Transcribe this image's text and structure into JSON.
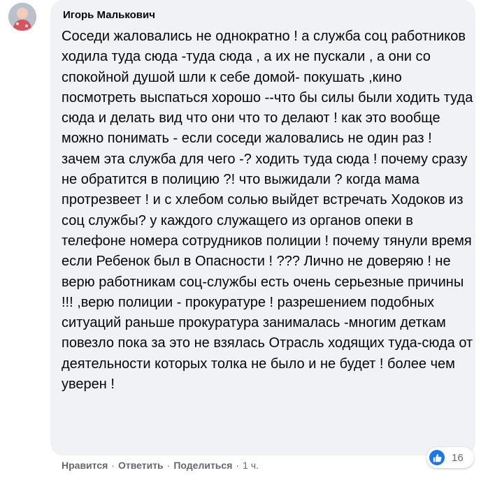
{
  "comment": {
    "author": "Игорь Малькович",
    "text": "Соседи жаловались не однократно ! а служба соц работников ходила туда сюда -туда сюда , а их не пускали , а они со спокойной душой шли к себе домой- покушать ,кино посмотреть выспаться хорошо --что бы силы были ходить туда сюда и делать вид что они что то делают ! как это вообще можно понимать - если соседи жаловались не один раз ! зачем эта служба для чего -? ходить туда сюда ! почему сразу не обратится в полицию ?! что выжидали ? когда мама протрезвеет ! и с хлебом солью выйдет встречать Ходоков из соц службы? у каждого служащего из органов опеки в телефоне номера сотрудников полиции ! почему тянули время если Ребенок был в Опасности ! ??? Лично не доверяю ! не верю работникам соц-службы есть очень серьезные причины !!! ,верю полиции - прокуратуре ! разрешением подобных ситуаций раньше прокуратура занималась -многим деткам повезло пока за это не взялась Отрасль ходящих туда-сюда от деятельности которых толка не было и не будет ! более чем уверен !",
    "reaction_count": "16",
    "reaction_icon": "like-icon",
    "actions": {
      "like": "Нравится",
      "reply": "Ответить",
      "share": "Поделиться",
      "separator": "·",
      "time": "1 ч."
    }
  },
  "colors": {
    "bubble": "#f0f2f5",
    "text": "#050505",
    "meta": "#65676b",
    "like_blue": "#1877f2"
  }
}
